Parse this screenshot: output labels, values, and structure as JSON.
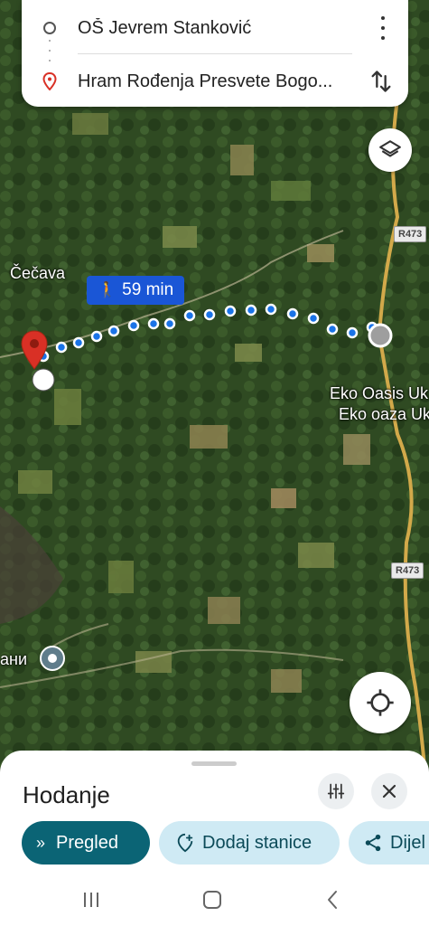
{
  "route": {
    "origin": "OŠ Jevrem Stanković",
    "destination": "Hram Rođenja Presvete Bogo..."
  },
  "map": {
    "duration": "59 min",
    "places": {
      "cecava": "Čečava",
      "eko_oasis_1": "Eko Oasis Uk",
      "eko_oasis_2": "Eko oaza Uk",
      "ani": "ани"
    },
    "road_shield_top": "R473",
    "road_shield_bottom": "R473",
    "route_color": "#1a73e8",
    "destination_pin_color": "#d93025"
  },
  "sheet": {
    "title": "Hodanje",
    "chips": {
      "overview": "Pregled",
      "add_stops": "Dodaj stanice",
      "share": "Dijel"
    }
  },
  "icons": {
    "origin": "origin-ring-icon",
    "destination": "location-pin-icon",
    "menu": "more-vert-icon",
    "swap": "swap-vert-icon",
    "layers": "layers-icon",
    "locate": "my-location-icon",
    "walk": "walk-icon",
    "filter": "tune-icon",
    "close": "close-icon",
    "overview": "double-chevron-icon",
    "add_stop": "add-location-icon",
    "share": "share-icon",
    "recents": "recents-icon",
    "home": "home-icon",
    "back": "back-icon"
  }
}
